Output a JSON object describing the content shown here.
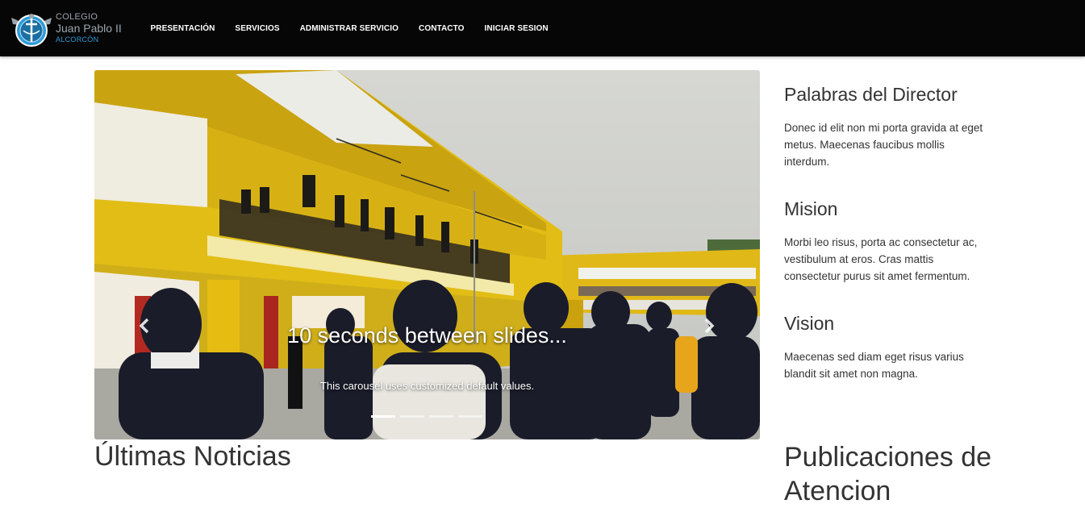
{
  "brand": {
    "small": "COLEGIO",
    "main": "Juan Pablo II",
    "city": "ALCORCÓN"
  },
  "nav": {
    "items": [
      {
        "label": "PRESENTACIÓN"
      },
      {
        "label": "SERVICIOS"
      },
      {
        "label": "ADMINISTRAR SERVICIO"
      },
      {
        "label": "CONTACTO"
      },
      {
        "label": "INICIAR SESION"
      }
    ]
  },
  "carousel": {
    "caption_title": "10 seconds between slides...",
    "caption_text": "This carousel uses customized default values.",
    "slide_count": 4,
    "active_index": 0,
    "prev_icon": "chevron-left-icon",
    "next_icon": "chevron-right-icon"
  },
  "sidebar": {
    "sections": [
      {
        "title": "Palabras del Director",
        "text": "Donec id elit non mi porta gravida at eget metus. Maecenas faucibus mollis interdum."
      },
      {
        "title": "Mision",
        "text": "Morbi leo risus, porta ac consectetur ac, vestibulum at eros. Cras mattis consectetur purus sit amet fermentum."
      },
      {
        "title": "Vision",
        "text": "Maecenas sed diam eget risus varius blandit sit amet non magna."
      }
    ],
    "heading": "Publicaciones de Atencion"
  },
  "main": {
    "news_heading": "Últimas Noticias"
  },
  "colors": {
    "navbar": "#060606",
    "brand_accent": "#2f9bd8",
    "building_yellow": "#e8c21a",
    "text": "#333333"
  }
}
